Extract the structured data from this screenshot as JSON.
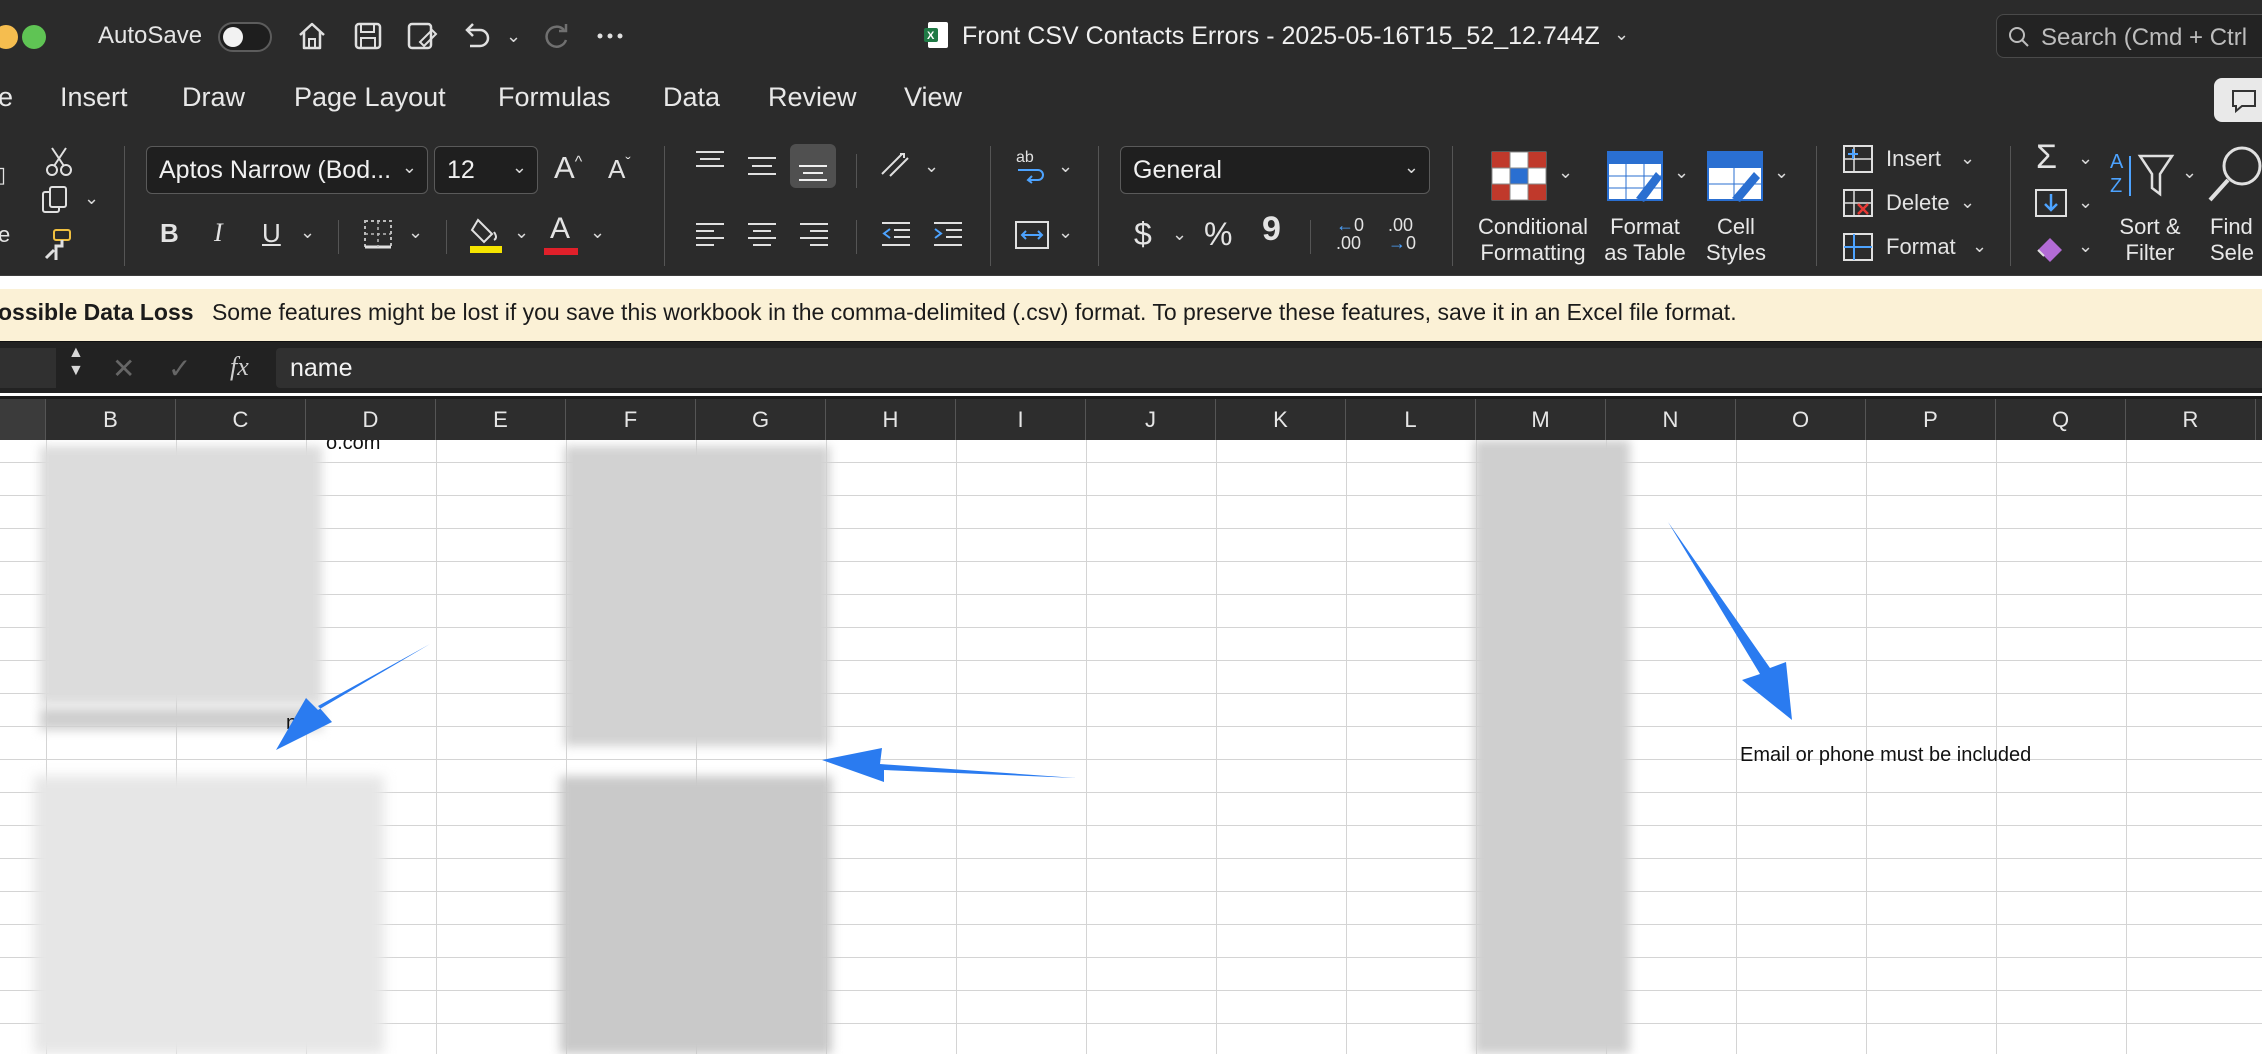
{
  "window": {
    "autosave_label": "AutoSave",
    "autosave_on": false,
    "title": "Front CSV Contacts Errors - 2025-05-16T15_52_12.744Z",
    "search_placeholder": "Search (Cmd + Ctrl"
  },
  "tabs": [
    {
      "label": "e"
    },
    {
      "label": "Insert"
    },
    {
      "label": "Draw"
    },
    {
      "label": "Page Layout"
    },
    {
      "label": "Formulas"
    },
    {
      "label": "Data"
    },
    {
      "label": "Review"
    },
    {
      "label": "View"
    }
  ],
  "ribbon": {
    "clipboard_label": "e",
    "font_name": "Aptos Narrow (Bod...",
    "font_size": "12",
    "grow_font": "A",
    "shrink_font": "A",
    "bold": "B",
    "italic": "I",
    "underline": "U",
    "font_color_letter": "A",
    "number_format": "General",
    "currency": "$",
    "percent": "%",
    "comma": "9",
    "increase_decimal": ".00",
    "decrease_decimal": ".00",
    "conditional_formatting": [
      "Conditional",
      "Formatting"
    ],
    "format_as_table": [
      "Format",
      "as Table"
    ],
    "cell_styles": [
      "Cell",
      "Styles"
    ],
    "insert": "Insert",
    "delete": "Delete",
    "format": "Format",
    "sort_filter": [
      "Sort &",
      "Filter"
    ],
    "find_select": [
      "Find",
      "Sele"
    ],
    "colors": {
      "highlight": "#f5e400",
      "font_color": "#e0202a"
    }
  },
  "notice": {
    "title": "ossible Data Loss",
    "message": "Some features might be lost if you save this workbook in the comma-delimited (.csv) format. To preserve these features, save it in an Excel file format."
  },
  "formula_bar": {
    "fx": "fx",
    "value": "name"
  },
  "columns": [
    "B",
    "C",
    "D",
    "E",
    "F",
    "G",
    "H",
    "I",
    "J",
    "K",
    "L",
    "M",
    "N",
    "O",
    "P",
    "Q",
    "R"
  ],
  "cells": {
    "error_message": "Email or phone must be included",
    "partial_d1": "o.com",
    "partial_c9": "n"
  },
  "annotations": {
    "arrow_color": "#2a7bf0"
  }
}
